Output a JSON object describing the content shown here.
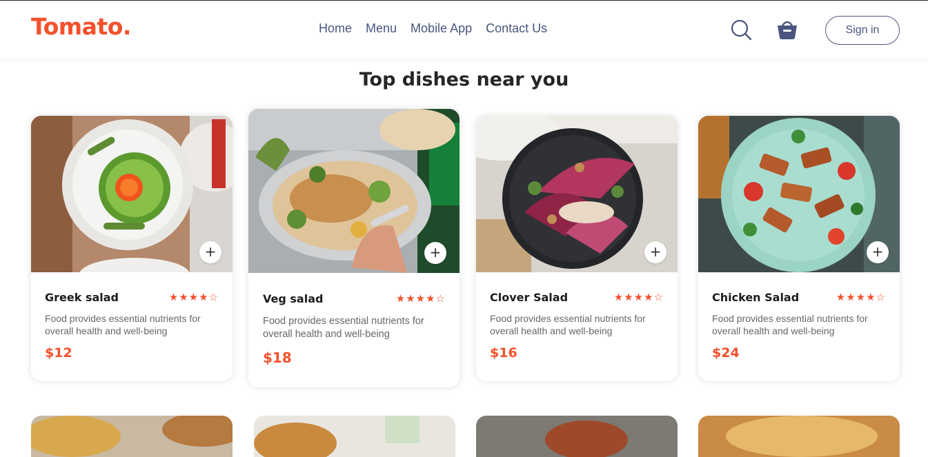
{
  "brand": {
    "logo": "Tomato."
  },
  "nav": {
    "items": [
      "Home",
      "Menu",
      "Mobile App",
      "Contact Us"
    ]
  },
  "header": {
    "signin_label": "Sign in"
  },
  "section": {
    "title": "Top dishes near you"
  },
  "colors": {
    "accent": "#f4512c",
    "nav": "#49557e"
  },
  "cards": [
    {
      "name": "Greek salad",
      "rating": "★★★★☆",
      "description": "Food provides essential nutrients for overall health and well-being",
      "price": "$12",
      "add": "+"
    },
    {
      "name": "Veg salad",
      "rating": "★★★★☆",
      "description": "Food provides essential nutrients for overall health and well-being",
      "price": "$18",
      "add": "+"
    },
    {
      "name": "Clover Salad",
      "rating": "★★★★☆",
      "description": "Food provides essential nutrients for overall health and well-being",
      "price": "$16",
      "add": "+"
    },
    {
      "name": "Chicken Salad",
      "rating": "★★★★☆",
      "description": "Food provides essential nutrients for overall health and well-being",
      "price": "$24",
      "add": "+"
    }
  ],
  "icons": {
    "search": "search-icon",
    "basket": "basket-icon",
    "add": "plus-icon"
  }
}
